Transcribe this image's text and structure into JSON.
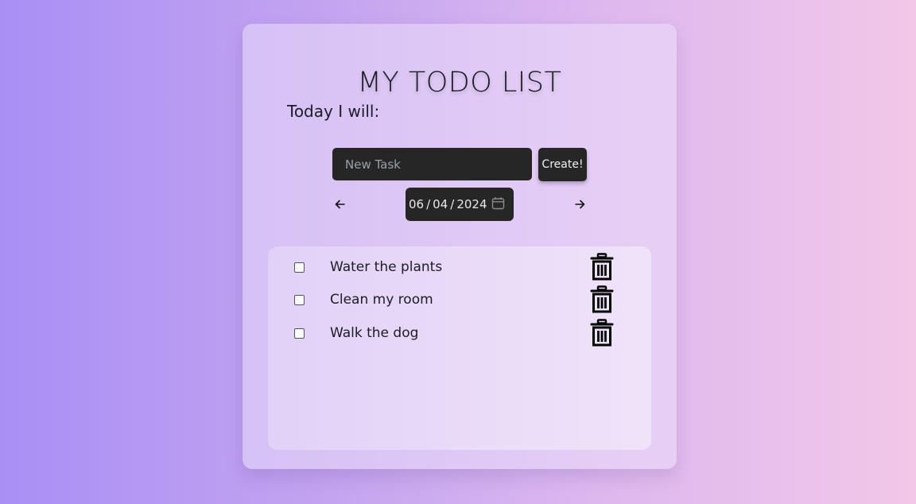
{
  "app": {
    "title": "MY TODO LIST",
    "subtitle": "Today I will:"
  },
  "new_task": {
    "placeholder": "New Task",
    "value": "",
    "create_label": "Create!"
  },
  "date_nav": {
    "month": "06",
    "day": "04",
    "year": "2024",
    "separator": "/",
    "prev_icon": "arrow-left-icon",
    "next_icon": "arrow-right-icon",
    "calendar_icon": "calendar-icon"
  },
  "tasks": [
    {
      "label": "Water the plants",
      "checked": false
    },
    {
      "label": "Clean my room",
      "checked": false
    },
    {
      "label": "Walk the dog",
      "checked": false
    }
  ],
  "icons": {
    "delete": "trash-icon"
  },
  "colors": {
    "dark_control": "#262626",
    "text": "#1c1c26",
    "gradient_start": "#a98ff5",
    "gradient_end": "#f2c7e8"
  }
}
